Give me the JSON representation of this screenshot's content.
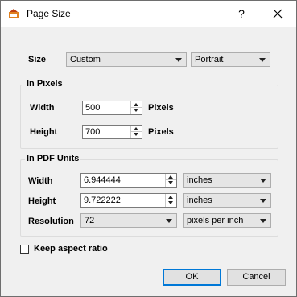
{
  "window": {
    "title": "Page Size"
  },
  "titlebar": {
    "help": "?"
  },
  "size": {
    "label": "Size",
    "value": "Custom",
    "orientation": "Portrait"
  },
  "pixels": {
    "group_title": "In Pixels",
    "width_label": "Width",
    "width_value": "500",
    "width_unit": "Pixels",
    "height_label": "Height",
    "height_value": "700",
    "height_unit": "Pixels"
  },
  "pdf": {
    "group_title": "In PDF Units",
    "width_label": "Width",
    "width_value": "6.944444",
    "width_unit": "inches",
    "height_label": "Height",
    "height_value": "9.722222",
    "height_unit": "inches",
    "resolution_label": "Resolution",
    "resolution_value": "72",
    "resolution_unit": "pixels per inch"
  },
  "aspect": {
    "label": "Keep aspect ratio",
    "checked": false
  },
  "buttons": {
    "ok": "OK",
    "cancel": "Cancel"
  }
}
